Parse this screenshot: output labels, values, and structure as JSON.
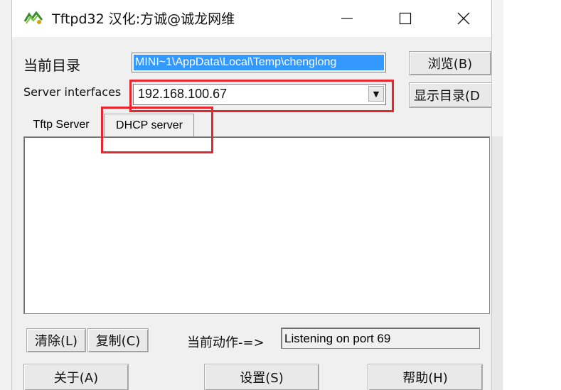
{
  "window": {
    "title": "Tftpd32 汉化:方诚@诚龙网维"
  },
  "titlebar_controls": {
    "minimize": "—",
    "maximize": "☐",
    "close": "✕"
  },
  "form": {
    "dir_label": "当前目录",
    "dir_value": "MINI~1\\AppData\\Local\\Temp\\chenglong",
    "browse_label": "浏览(B)",
    "iface_label": "Server interfaces",
    "iface_value": "192.168.100.67",
    "showdir_label": "显示目录(D"
  },
  "tabs": [
    {
      "label": "Tftp Server"
    },
    {
      "label": "DHCP server"
    }
  ],
  "bottom": {
    "clear_label": "清除(L)",
    "copy_label": "复制(C)",
    "action_label": "当前动作-=>",
    "status_value": "Listening on port 69",
    "about_label": "关于(A)",
    "settings_label": "设置(S)",
    "help_label": "帮助(H)"
  },
  "colors": {
    "highlight": "#e8262d",
    "selection": "#3399ff"
  }
}
